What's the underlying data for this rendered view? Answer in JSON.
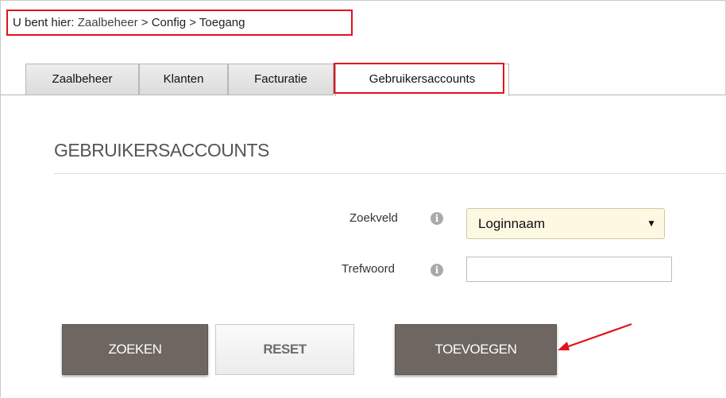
{
  "breadcrumb": {
    "prefix": "U bent hier:",
    "items": [
      "Zaalbeheer",
      "Config",
      "Toegang"
    ],
    "separator": ">"
  },
  "tabs": [
    {
      "label": "Zaalbeheer",
      "active": false
    },
    {
      "label": "Klanten",
      "active": false
    },
    {
      "label": "Facturatie",
      "active": false
    },
    {
      "label": "Gebruikersaccounts",
      "active": true
    }
  ],
  "section": {
    "title": "GEBRUIKERSACCOUNTS"
  },
  "form": {
    "search_field_label": "Zoekveld",
    "search_field_value": "Loginnaam",
    "keyword_label": "Trefwoord",
    "keyword_value": "",
    "info_icon_glyph": "i"
  },
  "buttons": {
    "search": "ZOEKEN",
    "reset": "RESET",
    "add": "TOEVOEGEN"
  },
  "colors": {
    "highlight_red": "#e0141e",
    "button_dark": "#6e6661",
    "select_bg": "#fdf8e1"
  },
  "icons": {
    "info": "info-icon",
    "dropdown": "caret-down-icon",
    "annotation": "red-arrow-icon"
  }
}
